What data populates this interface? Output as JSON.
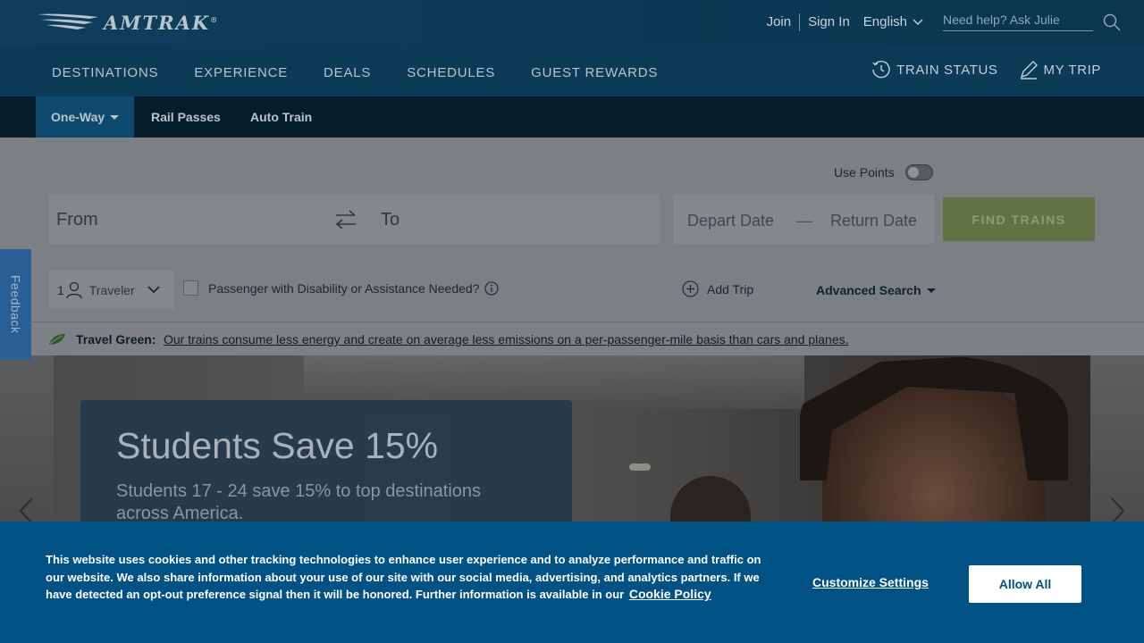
{
  "header": {
    "logo_text": "AMTRAK",
    "logo_mark": "®",
    "join": "Join",
    "sign_in": "Sign In",
    "language": "English",
    "help_placeholder": "Need help? Ask Julie"
  },
  "main_nav": {
    "items": [
      "DESTINATIONS",
      "EXPERIENCE",
      "DEALS",
      "SCHEDULES",
      "GUEST REWARDS"
    ],
    "train_status": "TRAIN STATUS",
    "my_trip": "MY TRIP"
  },
  "sub_nav": {
    "tabs": [
      "One-Way",
      "Rail Passes",
      "Auto Train"
    ],
    "active": "One-Way"
  },
  "booking": {
    "use_points": "Use Points",
    "from_placeholder": "From",
    "to_placeholder": "To",
    "depart_placeholder": "Depart Date",
    "date_separator": "—",
    "return_placeholder": "Return Date",
    "find_button": "FIND TRAINS",
    "traveler_count": "1",
    "traveler_label": "Traveler",
    "disability_label": "Passenger with Disability or Assistance Needed?",
    "add_trip": "Add Trip",
    "advanced_search": "Advanced Search"
  },
  "travel_green": {
    "label": "Travel Green:",
    "text": "Our trains consume less energy and create on average less emissions on a per-passenger-mile basis than cars and planes."
  },
  "hero": {
    "title": "Students Save 15%",
    "subtitle": "Students 17 - 24 save 15% to top destinations across America."
  },
  "feedback": "Feedback",
  "cookie": {
    "text": "This website uses cookies and other tracking technologies to enhance user experience and to analyze performance and traffic on our website. We also share information about your use of our site with our social media, advertising, and analytics partners. If we have detected an opt-out preference signal then it will be honored. Further information is available in our",
    "policy_link": "Cookie Policy",
    "customize": "Customize Settings",
    "allow_all": "Allow All"
  },
  "colors": {
    "cookie_bg": "#005184",
    "find_button": "#627243",
    "feedback_tab": "#2a5f95"
  }
}
